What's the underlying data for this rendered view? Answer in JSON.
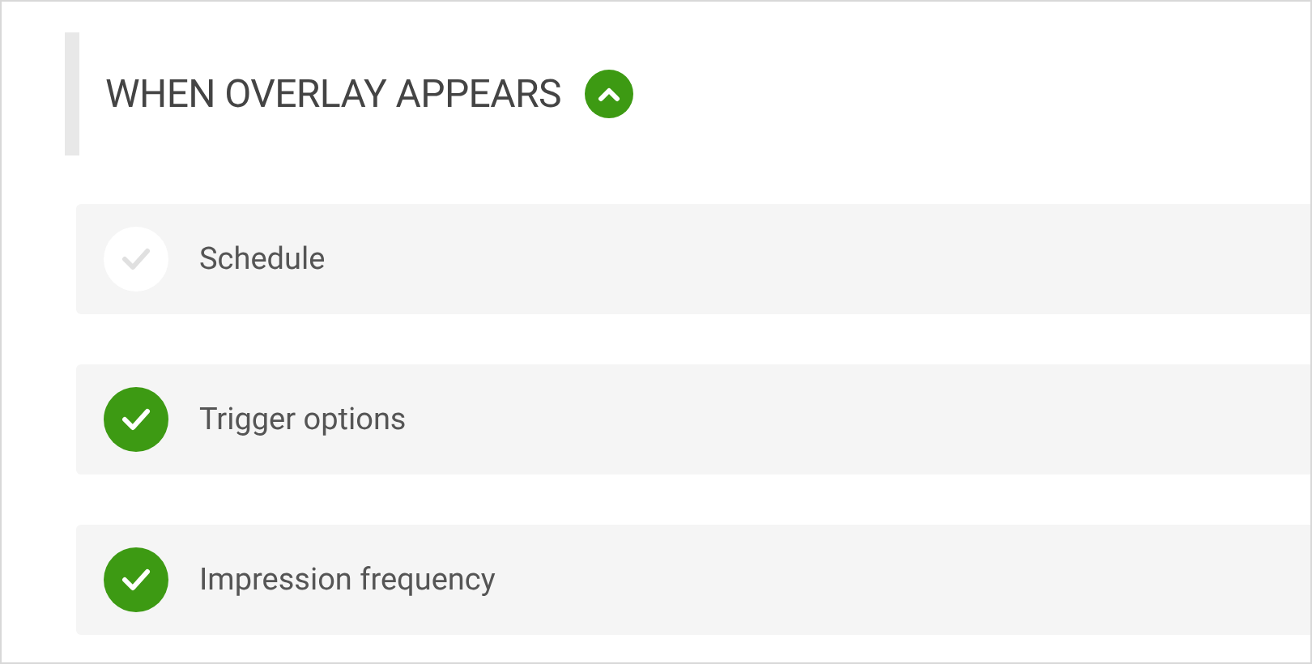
{
  "section": {
    "title": "WHEN OVERLAY APPEARS",
    "expanded": true
  },
  "steps": [
    {
      "label": "Schedule",
      "checked": false
    },
    {
      "label": "Trigger options",
      "checked": true
    },
    {
      "label": "Impression frequency",
      "checked": true
    }
  ]
}
